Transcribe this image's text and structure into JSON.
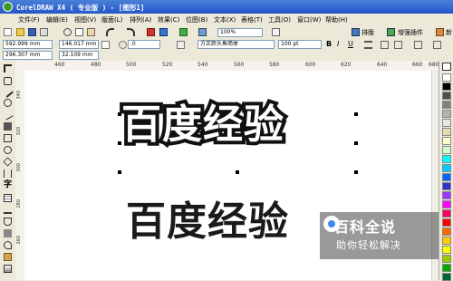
{
  "window": {
    "title": "CorelDRAW X4 ( 专业版 ) - [图形1]"
  },
  "menu": [
    "文件(F)",
    "编辑(E)",
    "视图(V)",
    "版面(L)",
    "排列(A)",
    "效果(C)",
    "位图(B)",
    "文本(X)",
    "表格(T)",
    "工具(O)",
    "窗口(W)",
    "帮助(H)"
  ],
  "toolbar1": {
    "zoom": "100%",
    "layout_label": "排版",
    "enhance_label": "增强插件",
    "new_label": "新"
  },
  "propbar": {
    "x": "592.999 mm",
    "y": "296.307 mm",
    "w": "146.017 mm",
    "h": "32.109 mm",
    "angle": ".0",
    "font": "方正胖头鱼简体",
    "size": "100 pt"
  },
  "ruler_h_labels": [
    "460",
    "480",
    "500",
    "520",
    "540",
    "560",
    "580",
    "600",
    "620",
    "640",
    "660",
    "680"
  ],
  "ruler_v_labels": [
    "340",
    "320",
    "300",
    "280",
    "260"
  ],
  "canvas": {
    "text_outlined": "百度经验",
    "text_filled": "百度经验"
  },
  "watermark": {
    "line1": "百科全说",
    "line2": "助你轻松解决"
  },
  "palette": [
    "#ffffff",
    "#000000",
    "#4d4d4d",
    "#808080",
    "#b3b3b3",
    "#e6e6e6",
    "#e6d9b3",
    "#ffffcc",
    "#ccffcc",
    "#00ffff",
    "#00ccff",
    "#0066ff",
    "#3333cc",
    "#9933ff",
    "#ff00ff",
    "#ff0066",
    "#ff0000",
    "#ff6600",
    "#ffcc00",
    "#ffff00",
    "#99cc00",
    "#00aa00",
    "#006633"
  ]
}
